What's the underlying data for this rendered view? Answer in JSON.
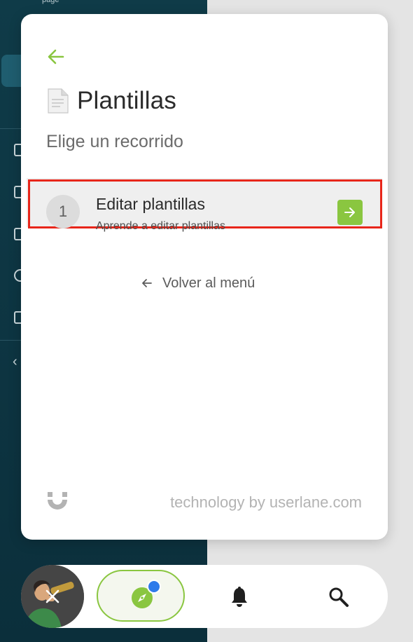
{
  "background_app": {
    "top_partial_text": "page"
  },
  "panel": {
    "back_icon": "arrow-left-icon",
    "title_icon": "document-icon",
    "title": "Plantillas",
    "subtitle": "Elige un recorrido",
    "tours": [
      {
        "number": "1",
        "title": "Editar plantillas",
        "description": "Aprende a editar plantillas",
        "action_icon": "arrow-right-icon"
      }
    ],
    "back_to_menu": "Volver al menú",
    "brand_text": "technology by userlane.com"
  },
  "bottom_bar": {
    "close_icon": "close-icon",
    "guides_icon": "compass-icon",
    "notifications_icon": "bell-icon",
    "search_icon": "search-icon"
  },
  "colors": {
    "accent_green": "#8ac640",
    "highlight_red": "#e8261a",
    "notification_blue": "#2f7bea",
    "sidebar_bg": "#0f3b48"
  }
}
